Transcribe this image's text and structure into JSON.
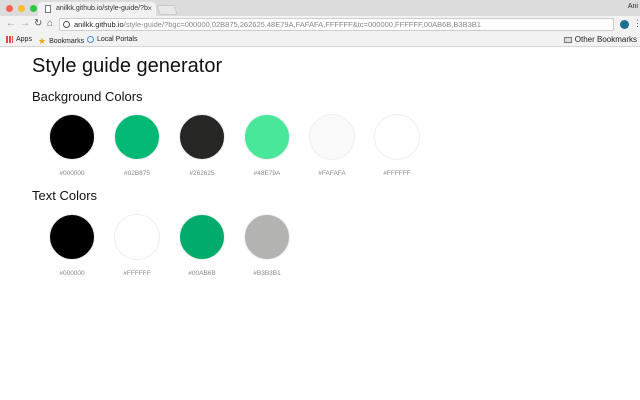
{
  "browser": {
    "tab_title": "anilkk.github.io/style-guide/?b",
    "user": "Ani",
    "url_host": "anilkk.github.io",
    "url_rest": "/style-guide/?bgc=000000,02B875,262625,48E79A,FAFAFA,FFFFFF&tc=000000,FFFFFF,00AB6B,B3B3B1",
    "bookmarks": [
      "Apps",
      "Bookmarks",
      "Local Portals"
    ],
    "other_bookmarks": "Other Bookmarks"
  },
  "page": {
    "title": "Style guide generator",
    "background_heading": "Background Colors",
    "text_heading": "Text Colors",
    "background_colors": [
      "#000000",
      "#02B875",
      "#262625",
      "#48E79A",
      "#FAFAFA",
      "#FFFFFF"
    ],
    "text_colors": [
      "#000000",
      "#FFFFFF",
      "#00AB6B",
      "#B3B3B1"
    ]
  }
}
